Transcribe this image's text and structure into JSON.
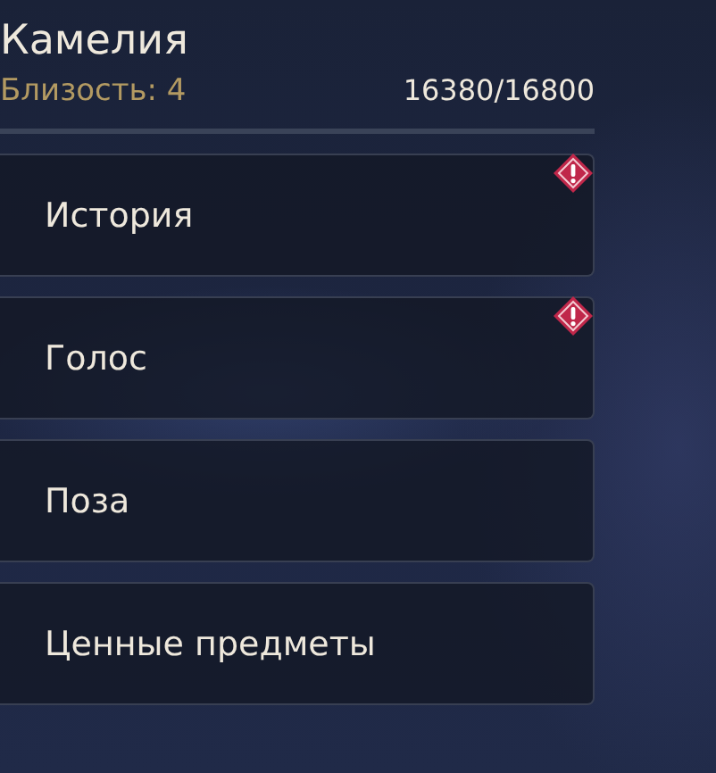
{
  "character": {
    "name": "Камелия",
    "affinity": "Близость: 4",
    "progress": "16380/16800"
  },
  "menu": [
    {
      "label": "История",
      "alert": true
    },
    {
      "label": "Голос",
      "alert": true
    },
    {
      "label": "Поза",
      "alert": false
    },
    {
      "label": "Ценные предметы",
      "alert": false
    }
  ]
}
